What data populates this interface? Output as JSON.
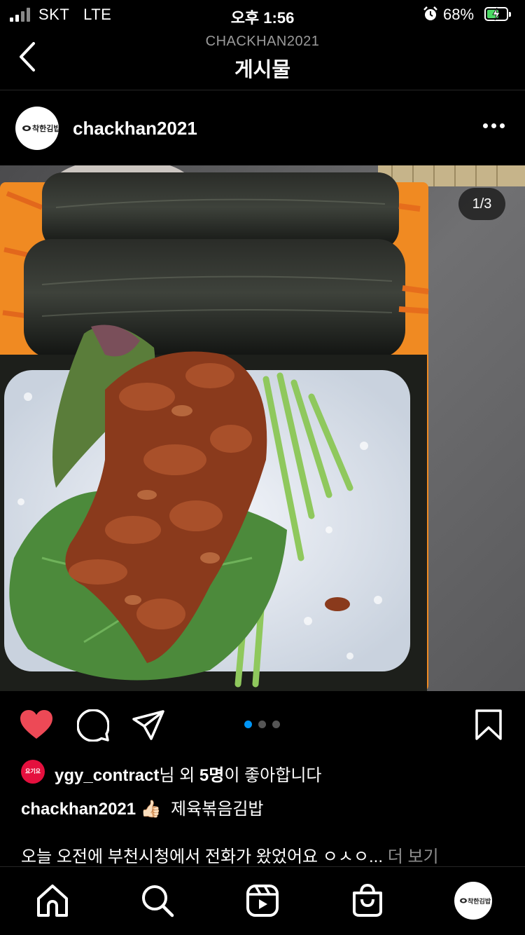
{
  "status_bar": {
    "carrier": "SKT",
    "network": "LTE",
    "time": "오후 1:56",
    "battery_percent": "68%"
  },
  "header": {
    "account": "CHACKHAN2021",
    "title": "게시물"
  },
  "post": {
    "username": "chackhan2021",
    "avatar_text": "착한김밥",
    "image_counter": "1/3",
    "image_alt": "김밥 사진",
    "carousel_total": 3,
    "carousel_active": 1,
    "liked": true
  },
  "likes": {
    "badge_text": "요기요",
    "liker": "ygy_contract",
    "suffix1": "님 외 ",
    "count": "5명",
    "suffix2": "이 좋아합니다"
  },
  "caption": {
    "username": "chackhan2021",
    "emoji": "👍🏻",
    "text": "제육볶음김밥"
  },
  "description": {
    "text": "오늘 오전에 부천시청에서 전화가 왔었어요 ㅇㅅㅇ...",
    "more_label": "더 보기"
  },
  "colors": {
    "like": "#ed4956",
    "accent_dot": "#0095f6",
    "badge": "#e4103e"
  },
  "nav": {
    "items": [
      "home-icon",
      "search-icon",
      "reels-icon",
      "shop-icon",
      "profile-avatar"
    ]
  }
}
